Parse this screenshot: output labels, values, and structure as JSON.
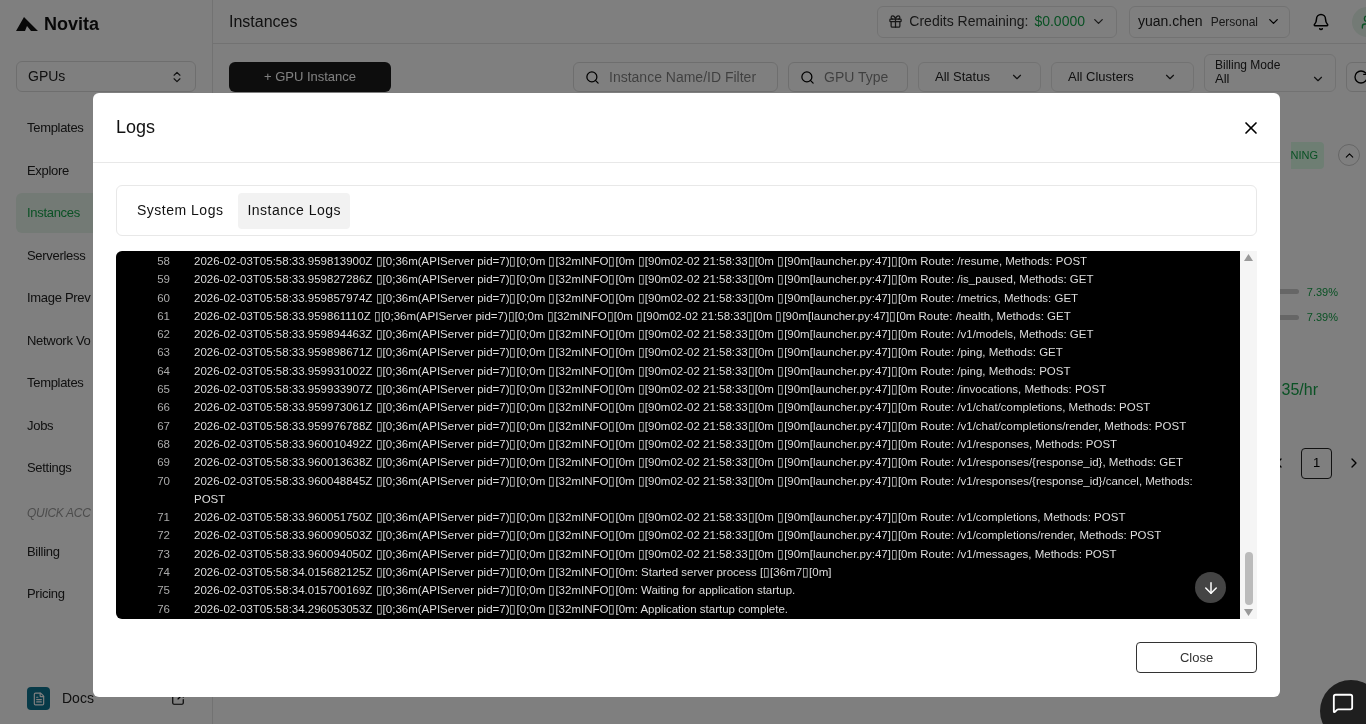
{
  "sidebar": {
    "logo": "Novita",
    "product_select": "GPUs",
    "items": [
      {
        "label": "Templates",
        "selected": false
      },
      {
        "label": "Explore",
        "selected": false
      },
      {
        "label": "Instances",
        "selected": true
      },
      {
        "label": "Serverless",
        "selected": false
      },
      {
        "label": "Image Prev",
        "selected": false
      },
      {
        "label": "Network Vo",
        "selected": false
      },
      {
        "label": "Templates",
        "selected": false
      },
      {
        "label": "Jobs",
        "selected": false
      },
      {
        "label": "Settings",
        "selected": false
      }
    ],
    "section_label": "QUICK ACC",
    "quick_items": [
      {
        "label": "Billing",
        "selected": false
      },
      {
        "label": "Pricing",
        "selected": false
      }
    ],
    "docs": "Docs"
  },
  "header": {
    "title": "Instances",
    "credits_label": "Credits Remaining:",
    "credits_value": "$0.0000",
    "user": "yuan.chen",
    "account_type": "Personal"
  },
  "toolbar": {
    "new_button": "+ GPU Instance",
    "name_filter_placeholder": "Instance Name/ID Filter",
    "gpu_type_placeholder": "GPU Type",
    "status_select": "All Status",
    "cluster_select": "All Clusters",
    "billing_mode_label": "Billing Mode",
    "billing_mode_value": "All"
  },
  "background": {
    "status_badge": "NING",
    "usage": [
      "7.39%",
      "7.39%"
    ],
    "price": "35/hr",
    "page": "1"
  },
  "modal": {
    "title": "Logs",
    "tabs": [
      {
        "label": "System Logs",
        "selected": false
      },
      {
        "label": "Instance Logs",
        "selected": true
      }
    ],
    "log_lines": [
      {
        "number": "58",
        "text": "2026-02-03T05:58:33.959813900Z ▯[0;36m(APIServer pid=7)▯[0;0m ▯[32mINFO▯[0m ▯[90m02-02 21:58:33▯[0m ▯[90m[launcher.py:47]▯[0m Route: /resume, Methods: POST"
      },
      {
        "number": "59",
        "text": "2026-02-03T05:58:33.959827286Z ▯[0;36m(APIServer pid=7)▯[0;0m ▯[32mINFO▯[0m ▯[90m02-02 21:58:33▯[0m ▯[90m[launcher.py:47]▯[0m Route: /is_paused, Methods: GET"
      },
      {
        "number": "60",
        "text": "2026-02-03T05:58:33.959857974Z ▯[0;36m(APIServer pid=7)▯[0;0m ▯[32mINFO▯[0m ▯[90m02-02 21:58:33▯[0m ▯[90m[launcher.py:47]▯[0m Route: /metrics, Methods: GET"
      },
      {
        "number": "61",
        "text": "2026-02-03T05:58:33.959861110Z ▯[0;36m(APIServer pid=7)▯[0;0m ▯[32mINFO▯[0m ▯[90m02-02 21:58:33▯[0m ▯[90m[launcher.py:47]▯[0m Route: /health, Methods: GET"
      },
      {
        "number": "62",
        "text": "2026-02-03T05:58:33.959894463Z ▯[0;36m(APIServer pid=7)▯[0;0m ▯[32mINFO▯[0m ▯[90m02-02 21:58:33▯[0m ▯[90m[launcher.py:47]▯[0m Route: /v1/models, Methods: GET"
      },
      {
        "number": "63",
        "text": "2026-02-03T05:58:33.959898671Z ▯[0;36m(APIServer pid=7)▯[0;0m ▯[32mINFO▯[0m ▯[90m02-02 21:58:33▯[0m ▯[90m[launcher.py:47]▯[0m Route: /ping, Methods: GET"
      },
      {
        "number": "64",
        "text": "2026-02-03T05:58:33.959931002Z ▯[0;36m(APIServer pid=7)▯[0;0m ▯[32mINFO▯[0m ▯[90m02-02 21:58:33▯[0m ▯[90m[launcher.py:47]▯[0m Route: /ping, Methods: POST"
      },
      {
        "number": "65",
        "text": "2026-02-03T05:58:33.959933907Z ▯[0;36m(APIServer pid=7)▯[0;0m ▯[32mINFO▯[0m ▯[90m02-02 21:58:33▯[0m ▯[90m[launcher.py:47]▯[0m Route: /invocations, Methods: POST"
      },
      {
        "number": "66",
        "text": "2026-02-03T05:58:33.959973061Z ▯[0;36m(APIServer pid=7)▯[0;0m ▯[32mINFO▯[0m ▯[90m02-02 21:58:33▯[0m ▯[90m[launcher.py:47]▯[0m Route: /v1/chat/completions, Methods: POST"
      },
      {
        "number": "67",
        "text": "2026-02-03T05:58:33.959976788Z ▯[0;36m(APIServer pid=7)▯[0;0m ▯[32mINFO▯[0m ▯[90m02-02 21:58:33▯[0m ▯[90m[launcher.py:47]▯[0m Route: /v1/chat/completions/render, Methods: POST"
      },
      {
        "number": "68",
        "text": "2026-02-03T05:58:33.960010492Z ▯[0;36m(APIServer pid=7)▯[0;0m ▯[32mINFO▯[0m ▯[90m02-02 21:58:33▯[0m ▯[90m[launcher.py:47]▯[0m Route: /v1/responses, Methods: POST"
      },
      {
        "number": "69",
        "text": "2026-02-03T05:58:33.960013638Z ▯[0;36m(APIServer pid=7)▯[0;0m ▯[32mINFO▯[0m ▯[90m02-02 21:58:33▯[0m ▯[90m[launcher.py:47]▯[0m Route: /v1/responses/{response_id}, Methods: GET"
      },
      {
        "number": "70",
        "text": "2026-02-03T05:58:33.960048845Z ▯[0;36m(APIServer pid=7)▯[0;0m ▯[32mINFO▯[0m ▯[90m02-02 21:58:33▯[0m ▯[90m[launcher.py:47]▯[0m Route: /v1/responses/{response_id}/cancel, Methods: POST"
      },
      {
        "number": "71",
        "text": "2026-02-03T05:58:33.960051750Z ▯[0;36m(APIServer pid=7)▯[0;0m ▯[32mINFO▯[0m ▯[90m02-02 21:58:33▯[0m ▯[90m[launcher.py:47]▯[0m Route: /v1/completions, Methods: POST"
      },
      {
        "number": "72",
        "text": "2026-02-03T05:58:33.960090503Z ▯[0;36m(APIServer pid=7)▯[0;0m ▯[32mINFO▯[0m ▯[90m02-02 21:58:33▯[0m ▯[90m[launcher.py:47]▯[0m Route: /v1/completions/render, Methods: POST"
      },
      {
        "number": "73",
        "text": "2026-02-03T05:58:33.960094050Z ▯[0;36m(APIServer pid=7)▯[0;0m ▯[32mINFO▯[0m ▯[90m02-02 21:58:33▯[0m ▯[90m[launcher.py:47]▯[0m Route: /v1/messages, Methods: POST"
      },
      {
        "number": "74",
        "text": "2026-02-03T05:58:34.015682125Z ▯[0;36m(APIServer pid=7)▯[0;0m ▯[32mINFO▯[0m: Started server process [▯[36m7▯[0m]"
      },
      {
        "number": "75",
        "text": "2026-02-03T05:58:34.015700169Z ▯[0;36m(APIServer pid=7)▯[0;0m ▯[32mINFO▯[0m: Waiting for application startup."
      },
      {
        "number": "76",
        "text": "2026-02-03T05:58:34.296053053Z ▯[0;36m(APIServer pid=7)▯[0;0m ▯[32mINFO▯[0m: Application startup complete."
      }
    ],
    "close_button": "Close"
  }
}
